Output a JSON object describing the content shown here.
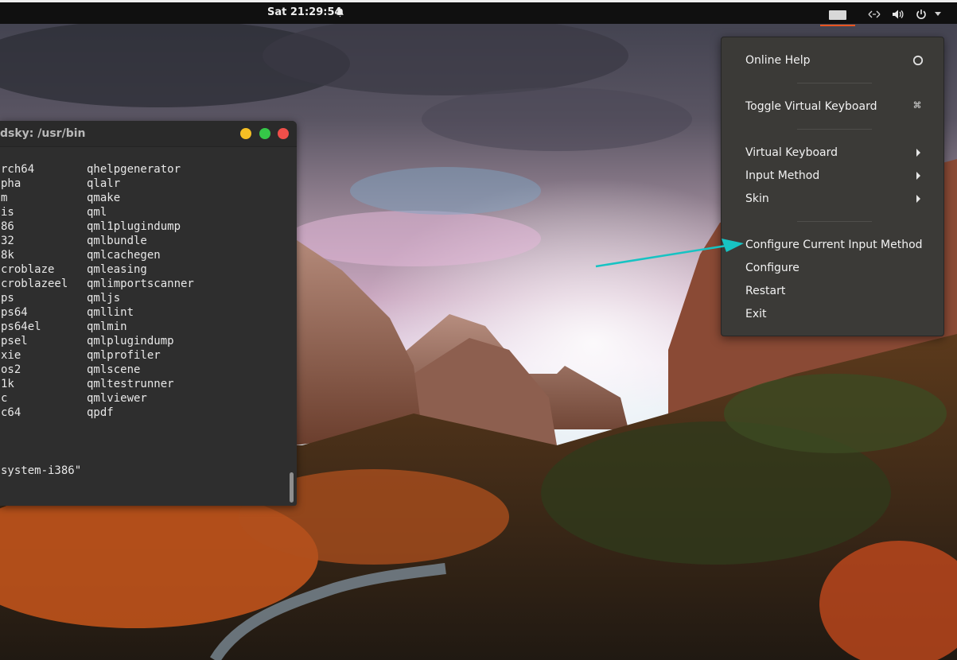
{
  "topbar": {
    "clock": "Sat 21:29:54",
    "icons": [
      "alarm-icon",
      "keyboard-indicator-icon",
      "network-icon",
      "volume-icon",
      "power-icon",
      "caret-down-icon"
    ],
    "accent": "#e95420"
  },
  "terminal": {
    "title_fragment": "dsky: /usr/bin",
    "rows": [
      [
        "rch64",
        "qhelpgenerator"
      ],
      [
        "pha",
        "qlalr"
      ],
      [
        "m",
        "qmake"
      ],
      [
        "is",
        "qml"
      ],
      [
        "86",
        "qml1plugindump"
      ],
      [
        "32",
        "qmlbundle"
      ],
      [
        "8k",
        "qmlcachegen"
      ],
      [
        "croblaze",
        "qmleasing"
      ],
      [
        "croblazeel",
        "qmlimportscanner"
      ],
      [
        "ps",
        "qmljs"
      ],
      [
        "ps64",
        "qmllint"
      ],
      [
        "ps64el",
        "qmlmin"
      ],
      [
        "psel",
        "qmlplugindump"
      ],
      [
        "xie",
        "qmlprofiler"
      ],
      [
        "os2",
        "qmlscene"
      ],
      [
        "1k",
        "qmltestrunner"
      ],
      [
        "c",
        "qmlviewer"
      ],
      [
        "c64",
        "qpdf"
      ]
    ],
    "last_line": "system-i386\"",
    "colors": {
      "min": "#f5bf24",
      "max": "#35c748",
      "close": "#ef4f4a"
    }
  },
  "menu": {
    "online_help": "Online Help",
    "toggle_virtual_keyboard": "Toggle Virtual Keyboard",
    "virtual_keyboard": "Virtual Keyboard",
    "input_method": "Input Method",
    "skin": "Skin",
    "configure_current_input_method": "Configure Current Input Method",
    "configure": "Configure",
    "restart": "Restart",
    "exit": "Exit"
  },
  "annotation": {
    "arrow_color": "#17c3c3"
  }
}
